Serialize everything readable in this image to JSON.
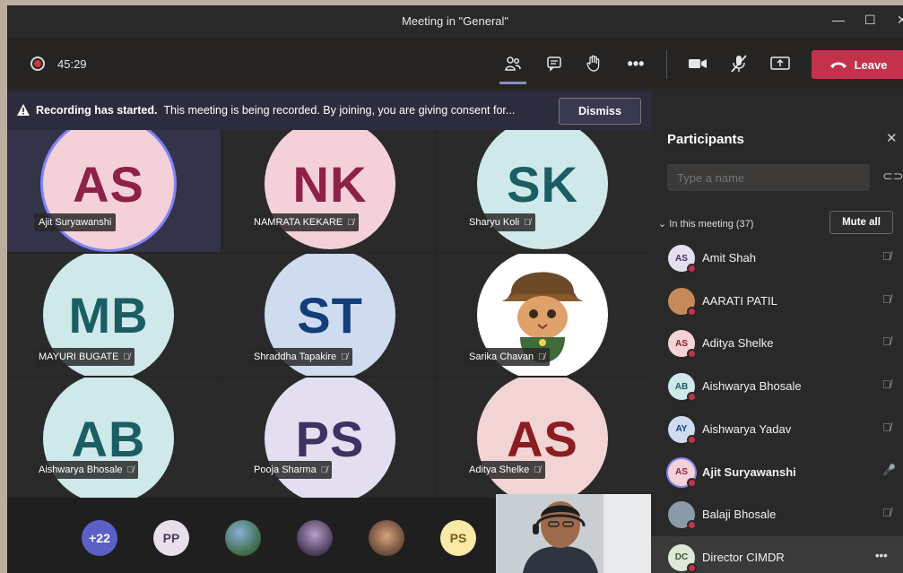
{
  "window": {
    "title": "Meeting in \"General\""
  },
  "toolbar": {
    "timer": "45:29",
    "leave_label": "Leave"
  },
  "banner": {
    "bold": "Recording has started.",
    "text": "This meeting is being recorded. By joining, you are giving consent for...",
    "dismiss": "Dismiss"
  },
  "tiles": [
    {
      "initials": "AS",
      "name": "Ajit Suryawanshi",
      "bg": "#f4d1d9",
      "fg": "#8e2148"
    },
    {
      "initials": "NK",
      "name": "NAMRATA KEKARE",
      "bg": "#f4d1d9",
      "fg": "#8e2148"
    },
    {
      "initials": "SK",
      "name": "Sharyu Koli",
      "bg": "#cfe8ea",
      "fg": "#1a5e63"
    },
    {
      "initials": "MB",
      "name": "MAYURI BUGATE",
      "bg": "#cfe8ea",
      "fg": "#1a5e63"
    },
    {
      "initials": "ST",
      "name": "Shraddha Tapakire",
      "bg": "#cfdcef",
      "fg": "#123d7a"
    },
    {
      "initials": "",
      "name": "Sarika Chavan",
      "bg": "#ffffff",
      "fg": "#000000"
    },
    {
      "initials": "AB",
      "name": "Aishwarya Bhosale",
      "bg": "#cfe8ea",
      "fg": "#1a5e63"
    },
    {
      "initials": "PS",
      "name": "Pooja Sharma",
      "bg": "#e4dff0",
      "fg": "#3f3262"
    },
    {
      "initials": "AS",
      "name": "Aditya Shelke",
      "bg": "#f3d4d4",
      "fg": "#8a1d22"
    }
  ],
  "strip": {
    "more": "+22",
    "pp": "PP",
    "ps": "PS"
  },
  "panel": {
    "title": "Participants",
    "search_placeholder": "Type a name",
    "in_meeting": "In this meeting (37)",
    "mute_all": "Mute all",
    "participants": [
      {
        "initials": "AS",
        "name": "Amit Shah",
        "bg": "#e4dff0",
        "fg": "#3f3262",
        "bold": false
      },
      {
        "initials": "",
        "name": "AARATI PATIL",
        "bg": "#c48a5a",
        "fg": "#ffffff",
        "bold": false
      },
      {
        "initials": "AS",
        "name": "Aditya Shelke",
        "bg": "#f3d4d4",
        "fg": "#8a1d22",
        "bold": false
      },
      {
        "initials": "AB",
        "name": "Aishwarya Bhosale",
        "bg": "#cfe8ea",
        "fg": "#1a5e63",
        "bold": false
      },
      {
        "initials": "AY",
        "name": "Aishwarya Yadav",
        "bg": "#cfdcef",
        "fg": "#123d7a",
        "bold": false
      },
      {
        "initials": "AS",
        "name": "Ajit Suryawanshi",
        "bg": "#f4d1d9",
        "fg": "#8e2148",
        "bold": true
      },
      {
        "initials": "",
        "name": "Balaji Bhosale",
        "bg": "#8a9aa8",
        "fg": "#ffffff",
        "bold": false
      },
      {
        "initials": "DC",
        "name": "Director CIMDR",
        "bg": "#dde8d8",
        "fg": "#3d5a30",
        "bold": false
      }
    ]
  }
}
